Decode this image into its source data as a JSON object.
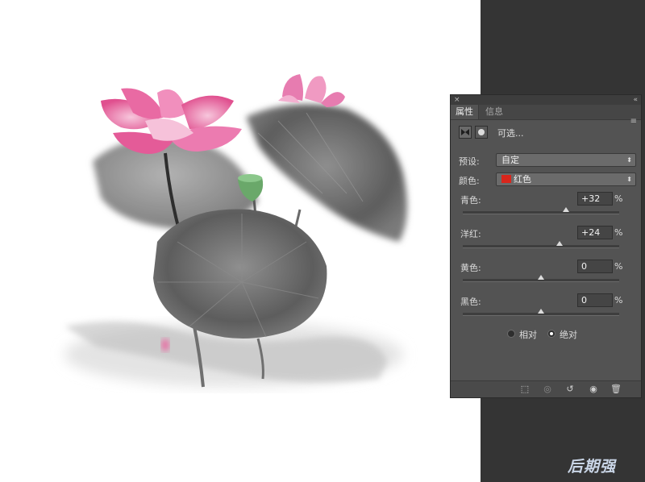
{
  "panel": {
    "close_glyph": "×",
    "collapse_glyph": "«",
    "menu_glyph": "≡",
    "tabs": [
      {
        "label": "属性",
        "active": true
      },
      {
        "label": "信息",
        "active": false
      }
    ],
    "title": "可选..."
  },
  "preset": {
    "label": "预设:",
    "value": "自定"
  },
  "colors": {
    "label": "颜色:",
    "value": "红色",
    "swatch": "#d9261c"
  },
  "sliders": [
    {
      "label": "青色:",
      "value": "+32",
      "unit": "%",
      "level": 32
    },
    {
      "label": "洋红:",
      "value": "+24",
      "unit": "%",
      "level": 24
    },
    {
      "label": "黄色:",
      "value": "0",
      "unit": "%",
      "level": 0
    },
    {
      "label": "黑色:",
      "value": "0",
      "unit": "%",
      "level": 0
    }
  ],
  "method": {
    "relative": "相对",
    "absolute": "绝对",
    "selected": "absolute"
  },
  "footer_icons": [
    "clip-to-layer-icon",
    "view-previous-icon",
    "reset-icon",
    "visibility-eye-icon",
    "trash-icon"
  ],
  "watermark": "后期强"
}
